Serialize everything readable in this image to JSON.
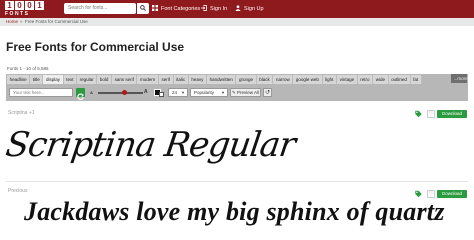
{
  "logo": {
    "letters": [
      "1",
      "0",
      "0",
      "1"
    ],
    "word": "FONTS"
  },
  "search": {
    "placeholder": "Search for fonts..."
  },
  "nav": {
    "categories": "Font Categories",
    "signin": "Sign In",
    "signup": "Sign Up"
  },
  "breadcrumb": {
    "home": "Home",
    "sep": "»",
    "current": "Free Fonts for Commercial Use"
  },
  "page_title": "Free Fonts for Commercial Use",
  "count_text": "Fonts 1 - 10 of 5,585",
  "toolbar": {
    "tabs": [
      "headline",
      "title",
      "display",
      "text",
      "regular",
      "bold",
      "sans serif",
      "modern",
      "serif",
      "italic",
      "heavy",
      "handwritten",
      "grunge",
      "black",
      "narrow",
      "google web",
      "light",
      "vintage",
      "retro",
      "wide",
      "outlined",
      "fat"
    ],
    "active_tab": "display",
    "more": "...more",
    "text_placeholder": "Your text here...",
    "size_label": "A",
    "size_max": "A",
    "size_value": 0.58,
    "sort": "24",
    "order": "Popularity",
    "preview_all": "Preview All"
  },
  "fonts": [
    {
      "name": "Scriptina +1",
      "sample": "Scriptina Regular",
      "download": "Download"
    },
    {
      "name": "Precious",
      "sample": "Jackdaws love my big sphinx of quartz",
      "download": "Download"
    }
  ],
  "colors": {
    "brand": "#8f1a1d",
    "download": "#2c9a3f",
    "toolbar": "#b7b7b7"
  }
}
